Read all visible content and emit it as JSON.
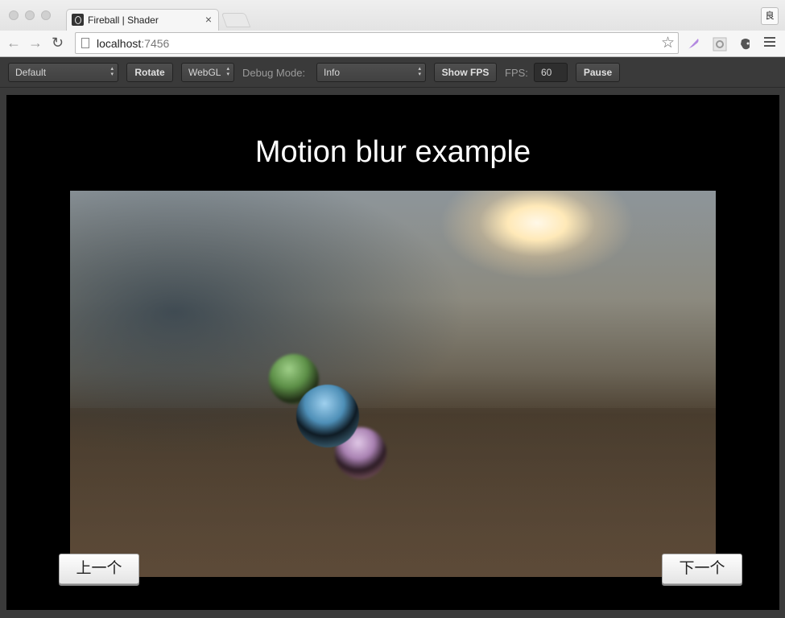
{
  "browser": {
    "tab_title": "Fireball | Shader",
    "tab_close": "×",
    "url_host": "localhost",
    "url_port": ":7456",
    "profile_label": "良"
  },
  "toolbar": {
    "preset_select": "Default",
    "rotate_button": "Rotate",
    "renderer_select": "WebGL",
    "debug_mode_label": "Debug Mode:",
    "debug_mode_select": "Info",
    "show_fps_button": "Show FPS",
    "fps_label": "FPS:",
    "fps_value": "60",
    "pause_button": "Pause"
  },
  "stage": {
    "heading": "Motion blur example",
    "prev_button": "上一个",
    "next_button": "下一个"
  },
  "colors": {
    "toolbar_bg": "#3a3a3a",
    "canvas_bg": "#000000",
    "heading": "#ffffff"
  }
}
